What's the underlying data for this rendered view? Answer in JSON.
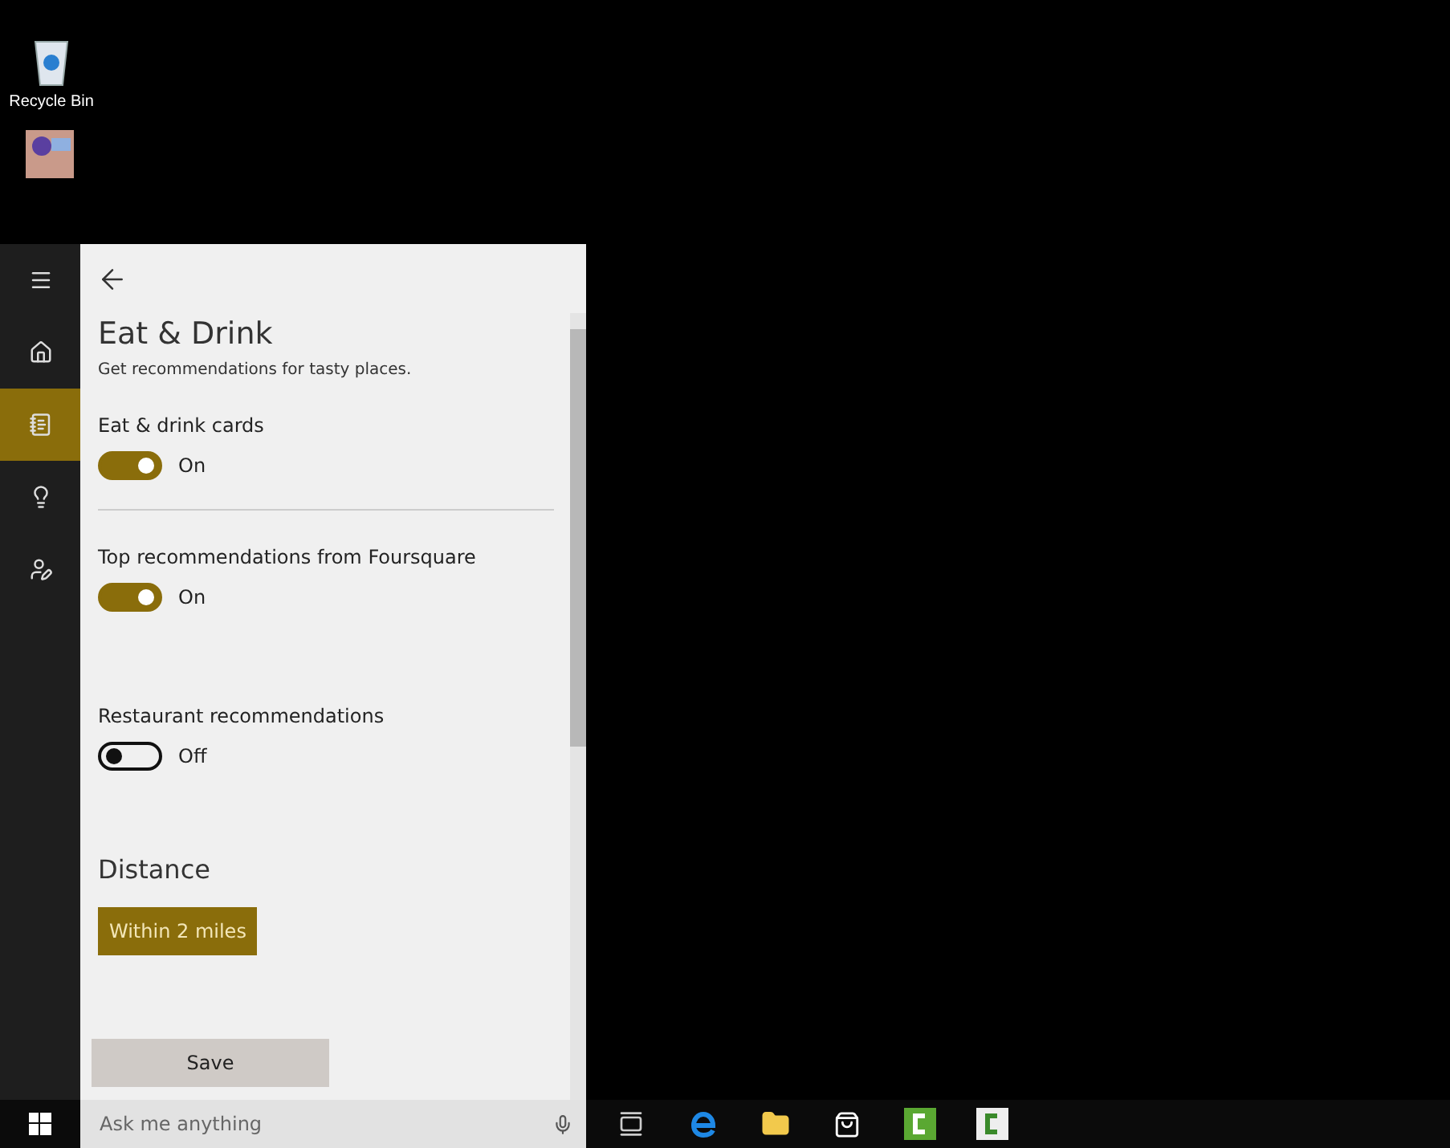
{
  "desktop_icons": [
    {
      "label": "Recycle Bin"
    }
  ],
  "nav": [
    {
      "selected": false
    },
    {
      "selected": false
    },
    {
      "selected": true
    },
    {
      "selected": false
    },
    {
      "selected": false
    }
  ],
  "panel": {
    "title": "Eat & Drink",
    "subtitle": "Get recommendations for tasty places.",
    "settings": [
      {
        "label": "Eat & drink cards",
        "on": true,
        "state_text": "On",
        "divider": true
      },
      {
        "label": "Top recommendations from Foursquare",
        "on": true,
        "state_text": "On",
        "divider": false
      },
      {
        "label": "Restaurant recommendations",
        "on": false,
        "state_text": "Off",
        "divider": false
      }
    ],
    "distance": {
      "heading": "Distance",
      "value": "Within 2 miles"
    },
    "save": "Save"
  },
  "taskbar": {
    "search_placeholder": "Ask me anything"
  }
}
